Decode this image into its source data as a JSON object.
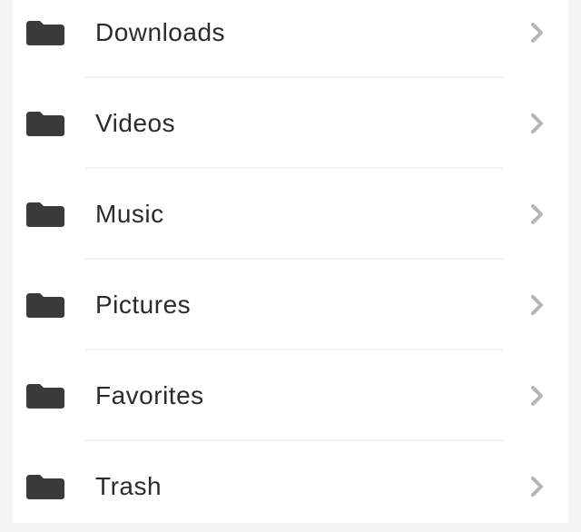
{
  "colors": {
    "background": "#f3f3f3",
    "panel": "#ffffff",
    "divider": "#f2f2f2",
    "text": "#2b2b2b",
    "icon": "#3a3a3a",
    "chevron": "#b5b5b5"
  },
  "icons": {
    "row_icon": "folder-icon",
    "trailing": "chevron-right-icon"
  },
  "file_list": {
    "items": [
      {
        "label": "Downloads"
      },
      {
        "label": "Videos"
      },
      {
        "label": "Music"
      },
      {
        "label": "Pictures"
      },
      {
        "label": "Favorites"
      },
      {
        "label": "Trash"
      }
    ]
  }
}
